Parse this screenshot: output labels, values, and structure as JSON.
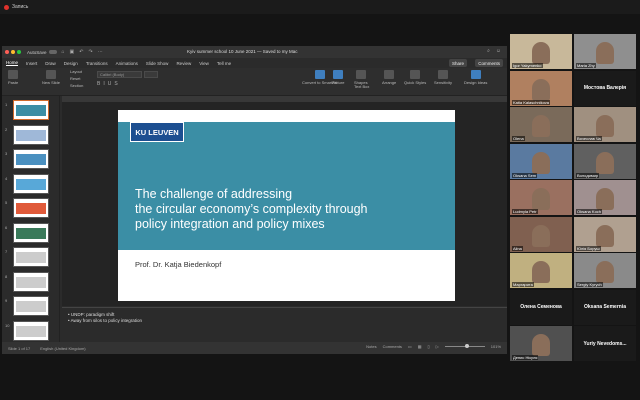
{
  "recording": {
    "label": "Запись"
  },
  "window": {
    "autosave_label": "AutoSave",
    "doc_title": "Kyiv summer school 10 June 2021 — Saved to my Mac"
  },
  "tabs": [
    "Home",
    "Insert",
    "Draw",
    "Design",
    "Transitions",
    "Animations",
    "Slide Show",
    "Review",
    "View",
    "Tell me"
  ],
  "toolbar": {
    "share_label": "Share",
    "comments_label": "Comments"
  },
  "ribbon": {
    "paste": "Paste",
    "new_slide": "New Slide",
    "layout": "Layout",
    "reset": "Reset",
    "section": "Section",
    "font_name": "Calibri (Body)",
    "convert_smartart": "Convert to SmartArt",
    "picture": "Picture",
    "shapes": "Shapes",
    "text_box": "Text Box",
    "arrange": "Arrange",
    "quick_styles": "Quick Styles",
    "sensitivity": "Sensitivity",
    "design_ideas": "Design Ideas"
  },
  "thumbnails": [
    {
      "num": "1",
      "color": "#3b8ea5"
    },
    {
      "num": "2",
      "color": "#9fb8d8"
    },
    {
      "num": "3",
      "color": "#4a90c0"
    },
    {
      "num": "4",
      "color": "#58a8d8"
    },
    {
      "num": "5",
      "color": "#e05a3a"
    },
    {
      "num": "6",
      "color": "#3a7a5a"
    },
    {
      "num": "7",
      "color": "#cccccc"
    },
    {
      "num": "8",
      "color": "#cccccc"
    },
    {
      "num": "9",
      "color": "#cccccc"
    },
    {
      "num": "10",
      "color": "#cccccc"
    }
  ],
  "slide": {
    "logo": "KU LEUVEN",
    "title_lines": [
      "The challenge of addressing",
      "the circular economy’s complexity through",
      "policy integration and policy mixes"
    ],
    "author": "Prof. Dr. Katja Biedenkopf"
  },
  "notes": [
    "•  UNDP: paradigm shift",
    "•  Away from silos to policy integration"
  ],
  "status": {
    "slide_counter": "Slide 1 of 17",
    "language": "English (United Kingdom)",
    "notes_label": "Notes",
    "comments_label": "Comments",
    "zoom": "101%"
  },
  "participants": [
    {
      "name": "Igor Yakymenko",
      "kind": "video",
      "bg": "#c8b89a"
    },
    {
      "name": "Maria Zhy",
      "kind": "video",
      "bg": "#8f8f8f"
    },
    {
      "name": "Katia Kalaschnikova",
      "kind": "video",
      "bg": "#b08060"
    },
    {
      "name": "Мостова Валерія",
      "kind": "name"
    },
    {
      "name": "Olena",
      "kind": "video",
      "bg": "#7a6a5a"
    },
    {
      "name": "Вячеслав Ча",
      "kind": "video",
      "bg": "#a09080"
    },
    {
      "name": "Oksana Sem",
      "kind": "video",
      "bg": "#5a7aa0"
    },
    {
      "name": "Володимир",
      "kind": "video",
      "bg": "#606060"
    },
    {
      "name": "Ludmyla Petr",
      "kind": "video",
      "bg": "#9a7060"
    },
    {
      "name": "Oksana Koch",
      "kind": "video",
      "bg": "#a09090"
    },
    {
      "name": "Alina",
      "kind": "video",
      "bg": "#806050"
    },
    {
      "name": "Юлія Боруш",
      "kind": "video",
      "bg": "#b0a090"
    },
    {
      "name": "Маргарита",
      "kind": "video",
      "bg": "#c0b080"
    },
    {
      "name": "Sergiy Kyrych",
      "kind": "video",
      "bg": "#8a8a8a"
    },
    {
      "name": "Олена Семенова",
      "kind": "name"
    },
    {
      "name": "Oksana Semernia",
      "kind": "name"
    },
    {
      "name": "Денис Нікуля",
      "kind": "video",
      "bg": "#505050"
    },
    {
      "name": "Yuriy Nevedoms...",
      "kind": "name"
    }
  ]
}
